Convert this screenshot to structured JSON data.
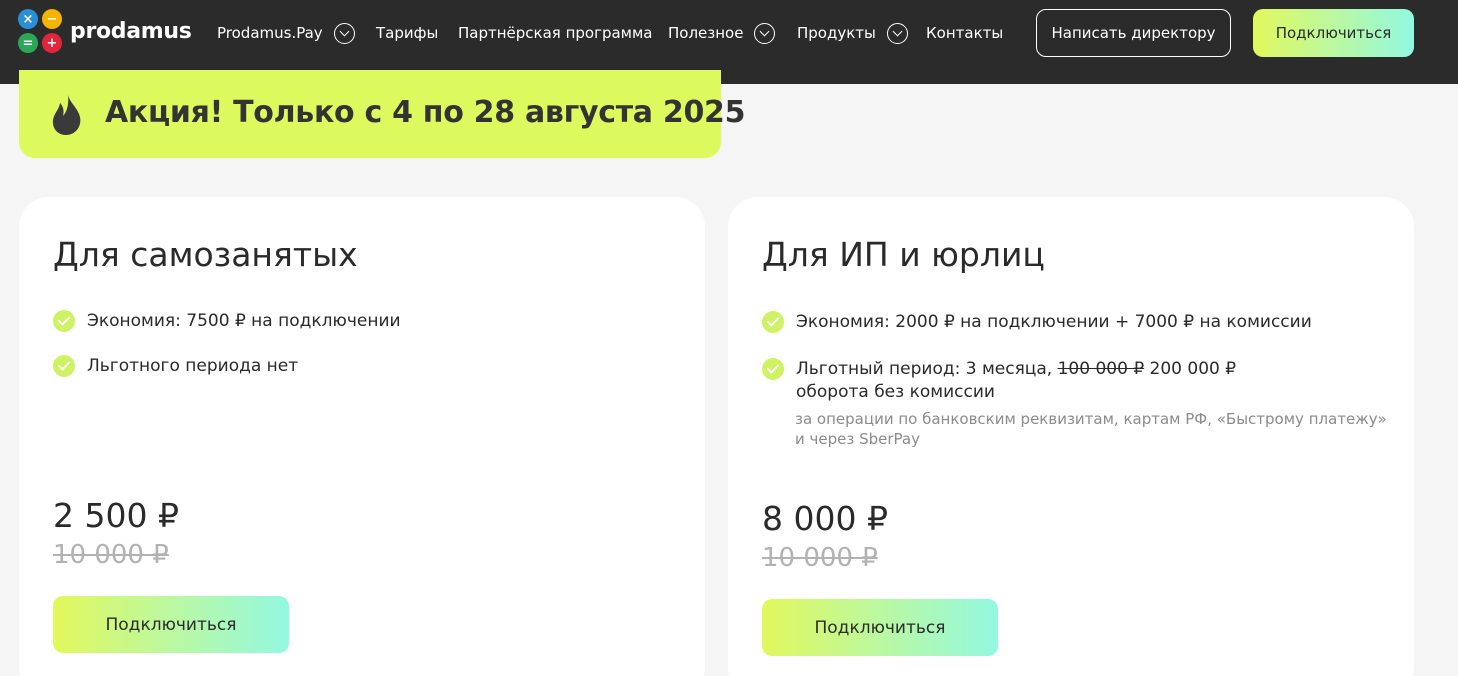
{
  "header": {
    "logo": {
      "text": "prodamus",
      "symbols": [
        "×",
        "−",
        "=",
        "+"
      ],
      "colors": [
        "#2a8fd6",
        "#f5b400",
        "#2ea65a",
        "#e1253b"
      ]
    },
    "nav": [
      {
        "label": "Prodamus.Pay",
        "has_dropdown": true
      },
      {
        "label": "Тарифы",
        "has_dropdown": false
      },
      {
        "label": "Партнёрская программа",
        "has_dropdown": false
      },
      {
        "label": "Полезное",
        "has_dropdown": true
      },
      {
        "label": "Продукты",
        "has_dropdown": true
      },
      {
        "label": "Контакты",
        "has_dropdown": false
      }
    ],
    "write_director_label": "Написать директору",
    "connect_label": "Подключиться"
  },
  "promo": {
    "icon": "fire-icon",
    "text": "Акция! Только с 4 по 28 августа 2025"
  },
  "cards": [
    {
      "title": "Для самозанятых",
      "features": [
        {
          "text": "Экономия: 7500 ₽ на подключении"
        },
        {
          "text": "Льготного периода нет"
        }
      ],
      "price": "2 500 ₽",
      "old_price": "10 000 ₽",
      "button_label": "Подключиться"
    },
    {
      "title": "Для ИП и юрлиц",
      "features": [
        {
          "text": "Экономия: 2000 ₽ на подключении + 7000 ₽ на комиссии"
        },
        {
          "prefix": "Льготный период: 3 месяца, ",
          "struck": "100 000 ₽",
          "suffix": " 200 000 ₽",
          "line2": "оборота без комиссии"
        }
      ],
      "note_line1": "за операции по банковским реквизитам, картам РФ, «Быстрому платежу»",
      "note_line2": "и через SberPay",
      "price": "8 000 ₽",
      "old_price": "10 000 ₽",
      "button_label": "Подключиться"
    }
  ],
  "colors": {
    "header_bg": "#2b2b2b",
    "promo_bg": "#dcfa5d",
    "check": "#cdf263",
    "button_gradient": [
      "#e2f85c",
      "#93f8e0"
    ]
  }
}
